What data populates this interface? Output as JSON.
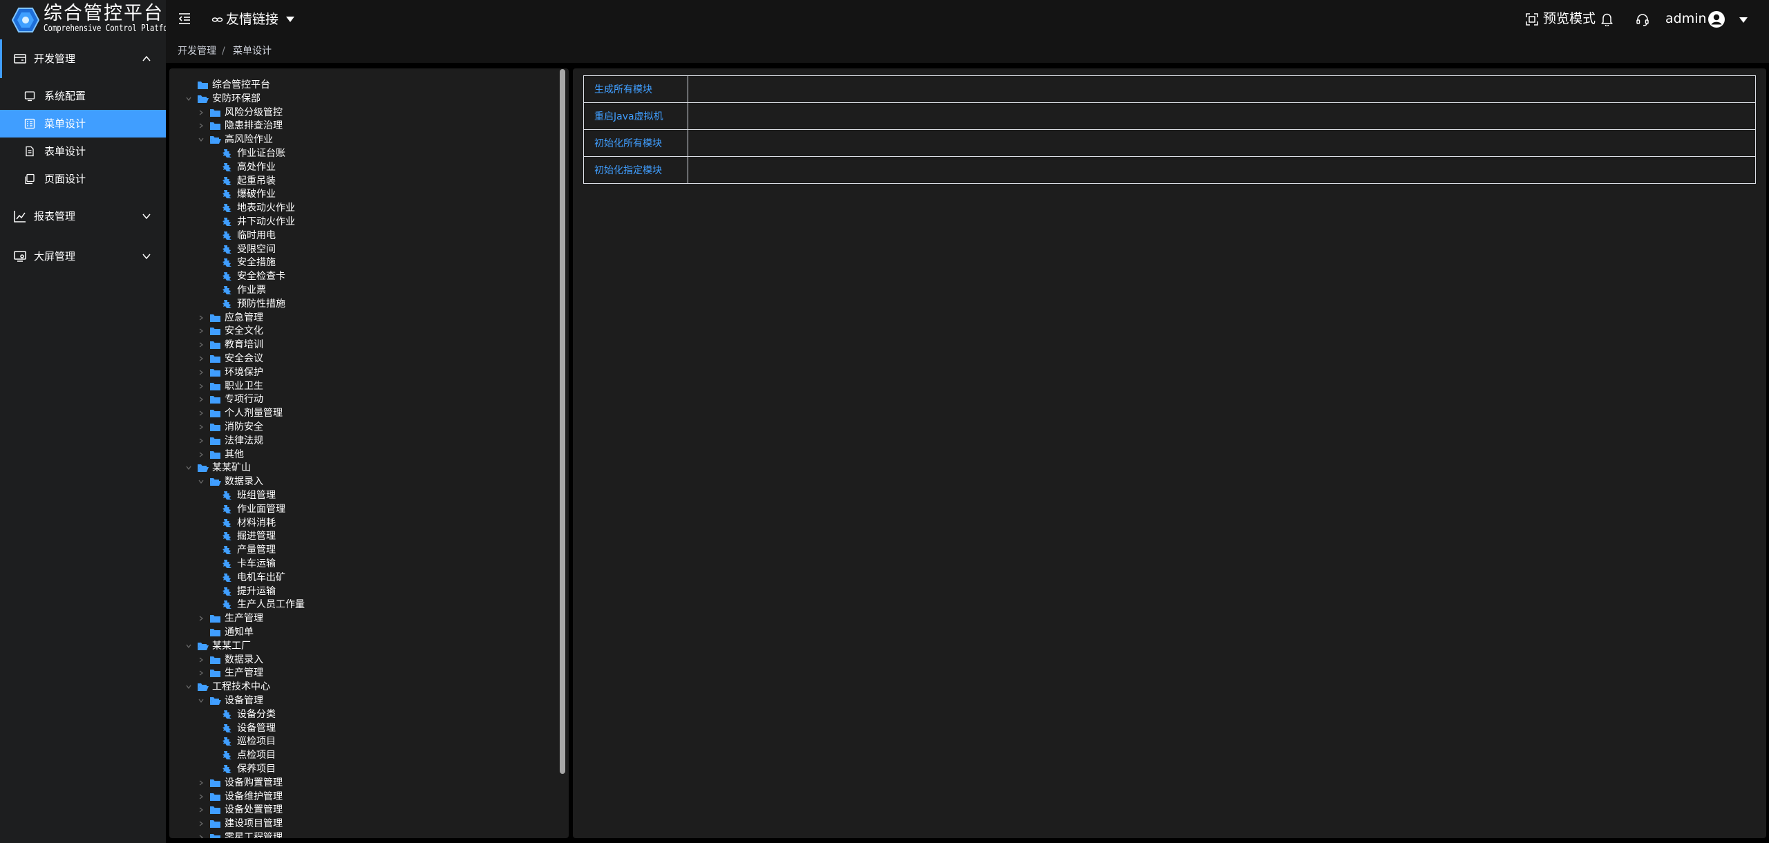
{
  "app": {
    "title": "综合管控平台",
    "subtitle": "Comprehensive Control Platform"
  },
  "sidebar": {
    "groups": [
      {
        "label": "开发管理",
        "icon": "dev-manage-icon",
        "expanded": true,
        "items": [
          {
            "label": "系统配置",
            "icon": "system-config-icon",
            "active": false
          },
          {
            "label": "菜单设计",
            "icon": "menu-design-icon",
            "active": true
          },
          {
            "label": "表单设计",
            "icon": "form-design-icon",
            "active": false
          },
          {
            "label": "页面设计",
            "icon": "page-design-icon",
            "active": false
          }
        ]
      },
      {
        "label": "报表管理",
        "icon": "report-chart-icon",
        "expanded": false
      },
      {
        "label": "大屏管理",
        "icon": "big-screen-icon",
        "expanded": false
      }
    ]
  },
  "header": {
    "link_label": "友情链接",
    "preview_label": "预览模式",
    "user_name": "admin"
  },
  "breadcrumb": {
    "items": [
      "开发管理",
      "菜单设计"
    ],
    "separator": "/"
  },
  "tree": {
    "nodes": [
      {
        "label": "综合管控平台",
        "level": 0,
        "kind": "folder",
        "toggle": "none"
      },
      {
        "label": "安防环保部",
        "level": 0,
        "kind": "folder-open",
        "toggle": "expanded"
      },
      {
        "label": "风险分级管控",
        "level": 1,
        "kind": "folder",
        "toggle": "collapsed"
      },
      {
        "label": "隐患排查治理",
        "level": 1,
        "kind": "folder",
        "toggle": "collapsed"
      },
      {
        "label": "高风险作业",
        "level": 1,
        "kind": "folder-open",
        "toggle": "expanded"
      },
      {
        "label": "作业证台账",
        "level": 2,
        "kind": "page",
        "toggle": "none"
      },
      {
        "label": "高处作业",
        "level": 2,
        "kind": "page",
        "toggle": "none"
      },
      {
        "label": "起重吊装",
        "level": 2,
        "kind": "page",
        "toggle": "none"
      },
      {
        "label": "爆破作业",
        "level": 2,
        "kind": "page",
        "toggle": "none"
      },
      {
        "label": "地表动火作业",
        "level": 2,
        "kind": "page",
        "toggle": "none"
      },
      {
        "label": "井下动火作业",
        "level": 2,
        "kind": "page",
        "toggle": "none"
      },
      {
        "label": "临时用电",
        "level": 2,
        "kind": "page",
        "toggle": "none"
      },
      {
        "label": "受限空间",
        "level": 2,
        "kind": "page",
        "toggle": "none"
      },
      {
        "label": "安全措施",
        "level": 2,
        "kind": "page",
        "toggle": "none"
      },
      {
        "label": "安全检查卡",
        "level": 2,
        "kind": "page",
        "toggle": "none"
      },
      {
        "label": "作业票",
        "level": 2,
        "kind": "page",
        "toggle": "none"
      },
      {
        "label": "预防性措施",
        "level": 2,
        "kind": "page",
        "toggle": "none"
      },
      {
        "label": "应急管理",
        "level": 1,
        "kind": "folder",
        "toggle": "collapsed"
      },
      {
        "label": "安全文化",
        "level": 1,
        "kind": "folder",
        "toggle": "collapsed"
      },
      {
        "label": "教育培训",
        "level": 1,
        "kind": "folder",
        "toggle": "collapsed"
      },
      {
        "label": "安全会议",
        "level": 1,
        "kind": "folder",
        "toggle": "collapsed"
      },
      {
        "label": "环境保护",
        "level": 1,
        "kind": "folder",
        "toggle": "collapsed"
      },
      {
        "label": "职业卫生",
        "level": 1,
        "kind": "folder",
        "toggle": "collapsed"
      },
      {
        "label": "专项行动",
        "level": 1,
        "kind": "folder",
        "toggle": "collapsed"
      },
      {
        "label": "个人剂量管理",
        "level": 1,
        "kind": "folder",
        "toggle": "collapsed"
      },
      {
        "label": "消防安全",
        "level": 1,
        "kind": "folder",
        "toggle": "collapsed"
      },
      {
        "label": "法律法规",
        "level": 1,
        "kind": "folder",
        "toggle": "collapsed"
      },
      {
        "label": "其他",
        "level": 1,
        "kind": "folder",
        "toggle": "collapsed"
      },
      {
        "label": "某某矿山",
        "level": 0,
        "kind": "folder-open",
        "toggle": "expanded"
      },
      {
        "label": "数据录入",
        "level": 1,
        "kind": "folder-open",
        "toggle": "expanded"
      },
      {
        "label": "班组管理",
        "level": 2,
        "kind": "page",
        "toggle": "none"
      },
      {
        "label": "作业面管理",
        "level": 2,
        "kind": "page",
        "toggle": "none"
      },
      {
        "label": "材料消耗",
        "level": 2,
        "kind": "page",
        "toggle": "none"
      },
      {
        "label": "掘进管理",
        "level": 2,
        "kind": "page",
        "toggle": "none"
      },
      {
        "label": "产量管理",
        "level": 2,
        "kind": "page",
        "toggle": "none"
      },
      {
        "label": "卡车运输",
        "level": 2,
        "kind": "page",
        "toggle": "none"
      },
      {
        "label": "电机车出矿",
        "level": 2,
        "kind": "page",
        "toggle": "none"
      },
      {
        "label": "提升运输",
        "level": 2,
        "kind": "page",
        "toggle": "none"
      },
      {
        "label": "生产人员工作量",
        "level": 2,
        "kind": "page",
        "toggle": "none"
      },
      {
        "label": "生产管理",
        "level": 1,
        "kind": "folder",
        "toggle": "collapsed"
      },
      {
        "label": "通知单",
        "level": 1,
        "kind": "folder",
        "toggle": "none"
      },
      {
        "label": "某某工厂",
        "level": 0,
        "kind": "folder-open",
        "toggle": "expanded"
      },
      {
        "label": "数据录入",
        "level": 1,
        "kind": "folder",
        "toggle": "collapsed"
      },
      {
        "label": "生产管理",
        "level": 1,
        "kind": "folder",
        "toggle": "collapsed"
      },
      {
        "label": "工程技术中心",
        "level": 0,
        "kind": "folder-open",
        "toggle": "expanded"
      },
      {
        "label": "设备管理",
        "level": 1,
        "kind": "folder-open",
        "toggle": "expanded"
      },
      {
        "label": "设备分类",
        "level": 2,
        "kind": "page",
        "toggle": "none"
      },
      {
        "label": "设备管理",
        "level": 2,
        "kind": "page",
        "toggle": "none"
      },
      {
        "label": "巡检项目",
        "level": 2,
        "kind": "page",
        "toggle": "none"
      },
      {
        "label": "点检项目",
        "level": 2,
        "kind": "page",
        "toggle": "none"
      },
      {
        "label": "保养项目",
        "level": 2,
        "kind": "page",
        "toggle": "none"
      },
      {
        "label": "设备购置管理",
        "level": 1,
        "kind": "folder",
        "toggle": "collapsed"
      },
      {
        "label": "设备维护管理",
        "level": 1,
        "kind": "folder",
        "toggle": "collapsed"
      },
      {
        "label": "设备处置管理",
        "level": 1,
        "kind": "folder",
        "toggle": "collapsed"
      },
      {
        "label": "建设项目管理",
        "level": 1,
        "kind": "folder",
        "toggle": "collapsed"
      },
      {
        "label": "零星工程管理",
        "level": 1,
        "kind": "folder",
        "toggle": "collapsed"
      }
    ]
  },
  "actions": [
    {
      "label": "生成所有模块"
    },
    {
      "label": "重启Java虚拟机"
    },
    {
      "label": "初始化所有模块"
    },
    {
      "label": "初始化指定模块"
    }
  ],
  "colors": {
    "accent": "#409eff",
    "sidebar_bg": "#1d1e1f",
    "panel_bg": "#1d1d1d",
    "header_bg": "#141414"
  }
}
